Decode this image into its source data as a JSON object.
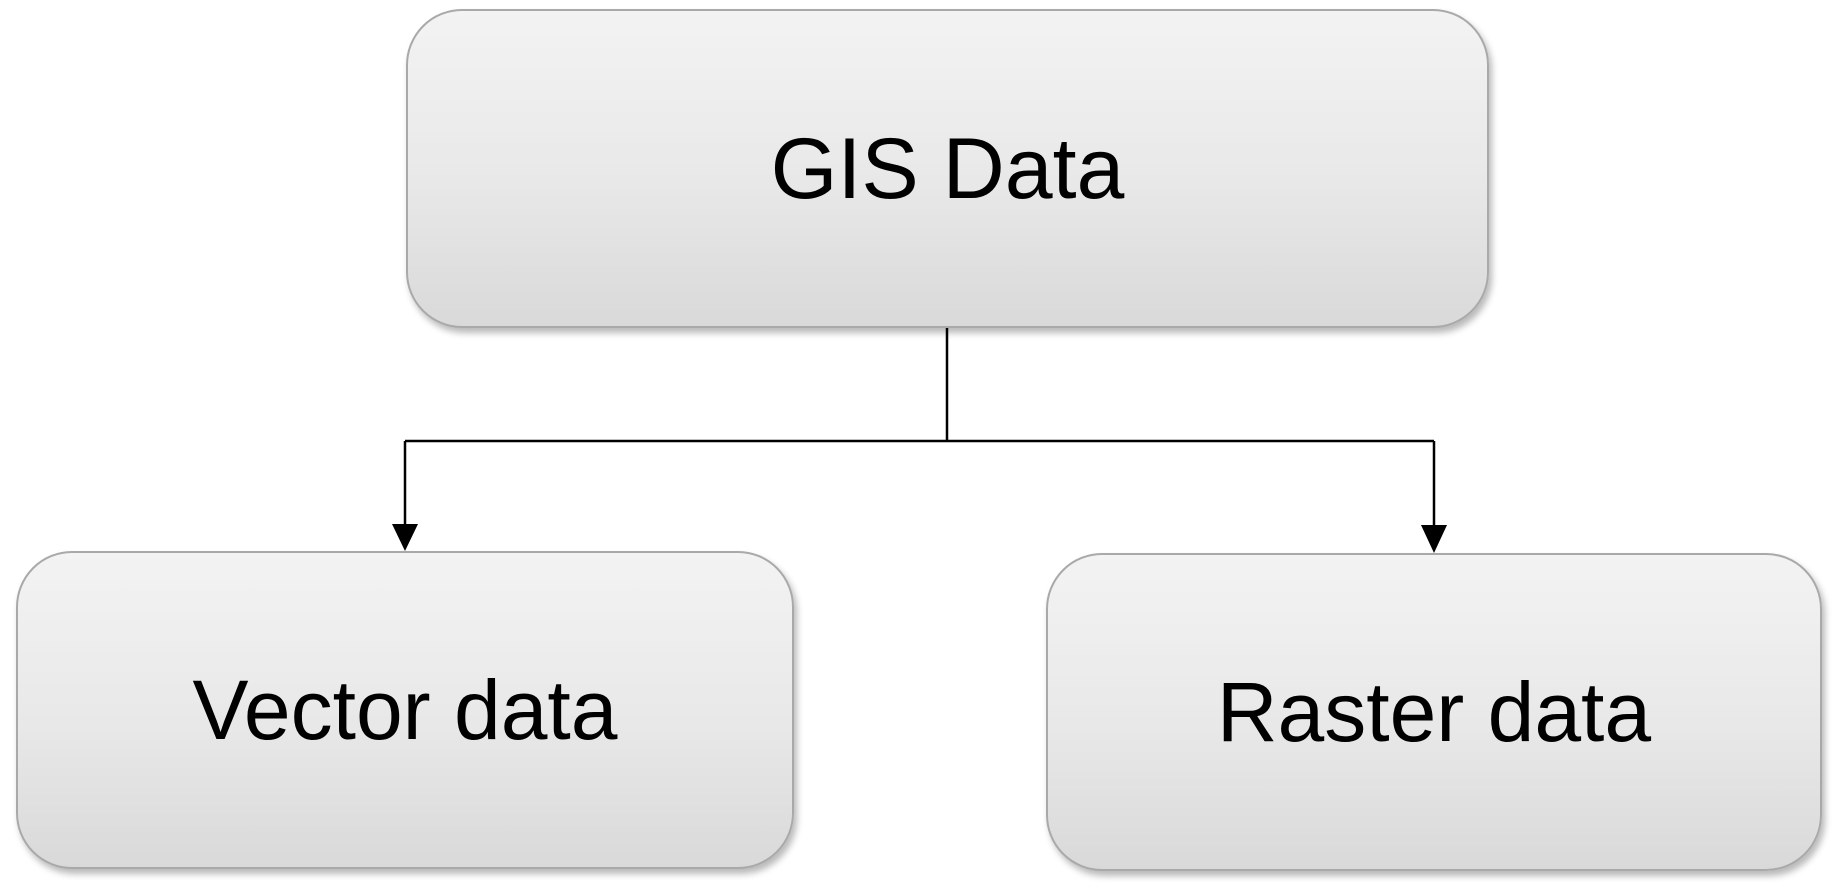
{
  "diagram": {
    "type": "hierarchy",
    "root": {
      "label": "GIS Data"
    },
    "children": [
      {
        "label": "Vector data"
      },
      {
        "label": "Raster data"
      }
    ],
    "colors": {
      "connector": "#000000",
      "node_border": "#a9a9a9",
      "node_fill_top": "#f3f3f3",
      "node_fill_bottom": "#d9d9d9",
      "text": "#000000"
    }
  }
}
